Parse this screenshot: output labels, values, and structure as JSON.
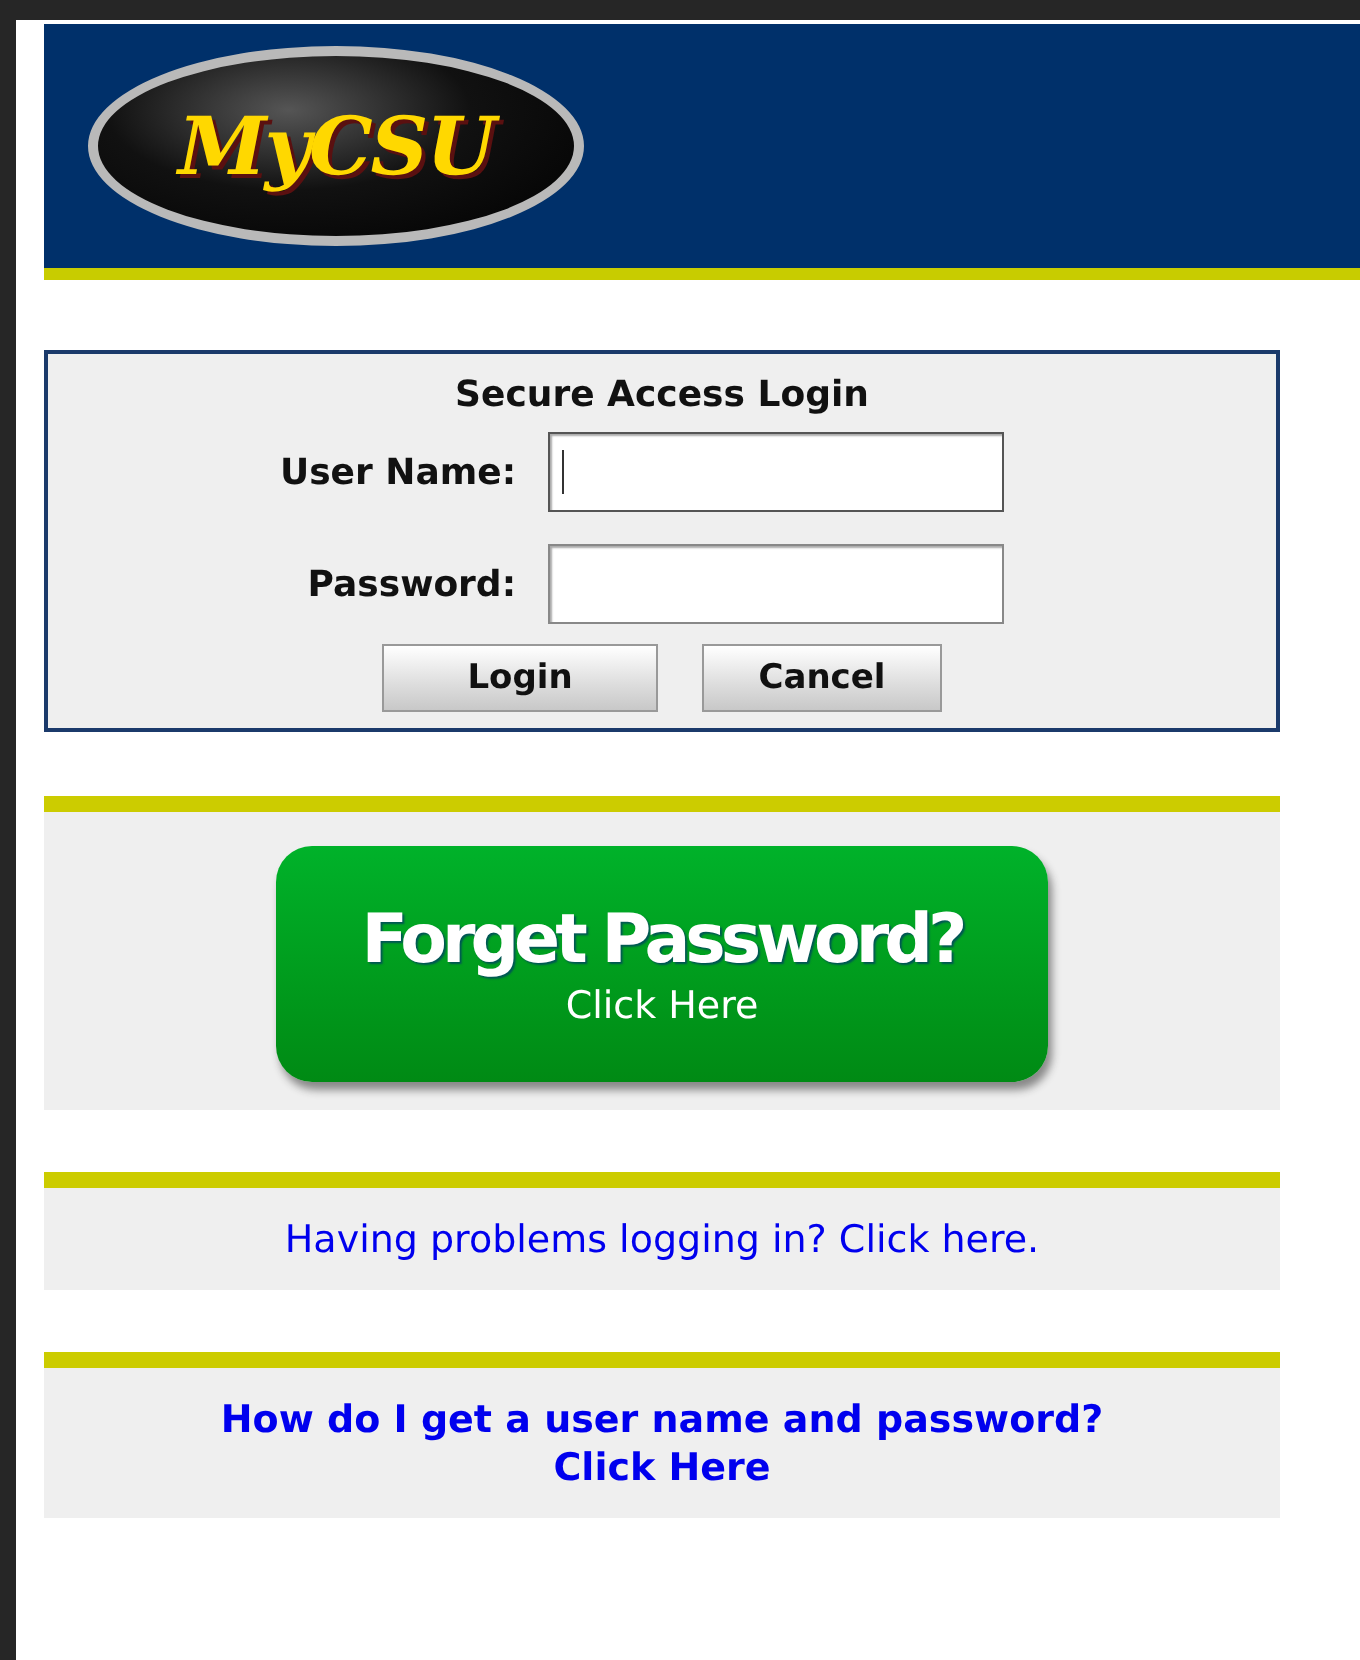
{
  "header": {
    "logo": "MyCSU"
  },
  "login": {
    "title": "Secure Access Login",
    "fields": [
      {
        "label": "User Name:",
        "focused": true
      },
      {
        "label": "Password:",
        "focused": false
      }
    ],
    "buttons": [
      "Login",
      "Cancel"
    ]
  },
  "forgot": {
    "title": "Forget Password?",
    "subtitle": "Click Here"
  },
  "links": [
    {
      "text": "Having problems logging in? Click here.",
      "bold": false
    },
    {
      "text": "How do I get a user name and password?\nClick Here",
      "bold": true
    }
  ]
}
